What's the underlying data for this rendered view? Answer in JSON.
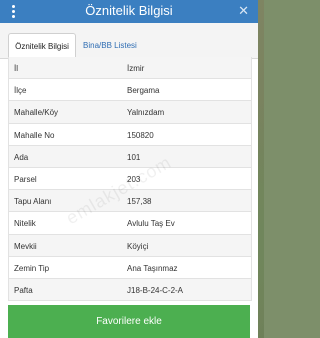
{
  "header": {
    "title": "Öznitelik Bilgisi",
    "menu_icon": "vertical-dots-icon",
    "close_icon": "close-icon",
    "close_glyph": "✕"
  },
  "tabs": [
    {
      "label": "Öznitelik Bilgisi",
      "active": true
    },
    {
      "label": "Bina/BB Listesi",
      "active": false
    }
  ],
  "attributes": [
    {
      "key": "İl",
      "value": "İzmir"
    },
    {
      "key": "İlçe",
      "value": "Bergama"
    },
    {
      "key": "Mahalle/Köy",
      "value": "Yalnızdam"
    },
    {
      "key": "Mahalle No",
      "value": "150820"
    },
    {
      "key": "Ada",
      "value": "101"
    },
    {
      "key": "Parsel",
      "value": "203"
    },
    {
      "key": "Tapu Alanı",
      "value": "157,38"
    },
    {
      "key": "Nitelik",
      "value": "Avlulu Taş Ev"
    },
    {
      "key": "Mevkii",
      "value": "Köyiçi"
    },
    {
      "key": "Zemin Tip",
      "value": "Ana Taşınmaz"
    },
    {
      "key": "Pafta",
      "value": "J18-B-24-C-2-A"
    }
  ],
  "favorite_button": {
    "label": "Favorilere ekle"
  },
  "watermark": "emlakjet.com",
  "brand": "emlakjet",
  "colors": {
    "header": "#3b7fc1",
    "favorite": "#4caf50",
    "tab_link": "#2f6db3"
  }
}
